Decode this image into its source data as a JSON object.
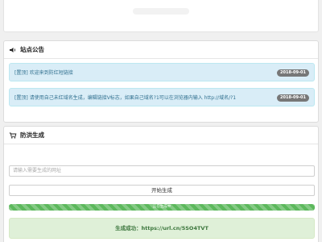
{
  "notice_panel": {
    "title": "站点公告",
    "icon": "volume-icon",
    "items": [
      {
        "tag": "[置顶]",
        "text": "欢迎来到防红短链接",
        "date": "2018-09-01"
      },
      {
        "tag": "[置顶]",
        "text": "请使用自己未红域名生成，编辑链接V标志，如果自己域名?1可以在浏览器内输入 http://域名/?1",
        "date": "2018-09-01"
      }
    ]
  },
  "generator_panel": {
    "title": "防洪生成",
    "icon": "cart-icon",
    "url_placeholder": "请输入需要生成的网址",
    "generate_button": "开始生成",
    "progress_label": "正在生成中",
    "progress_value": 1.0,
    "result_prefix": "生成成功：",
    "result_url": "https://url.cn/5SO4TVT"
  },
  "colors": {
    "info_bg": "#d9edf7",
    "info_text": "#31708f",
    "success_bg": "#dff0d8",
    "success_text": "#3c763d",
    "progress": "#5cb85c",
    "badge": "#777777"
  }
}
